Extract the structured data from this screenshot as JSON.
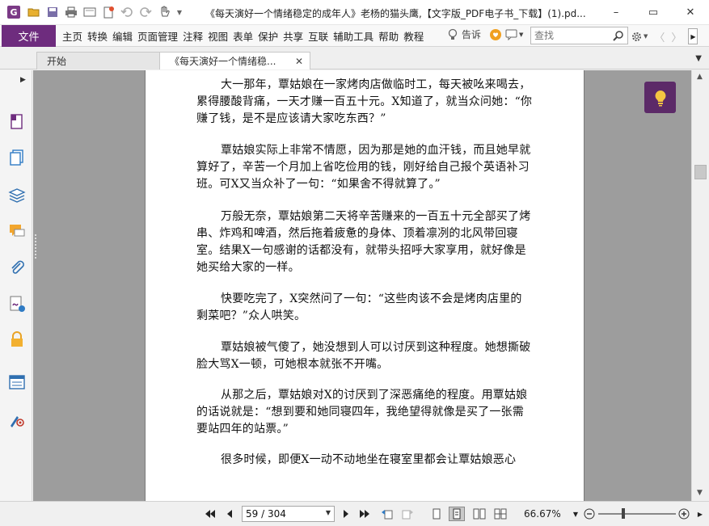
{
  "colors": {
    "brand": "#6e2c7e",
    "bulb_bg": "#5c2a68",
    "doc_background": "#9d9d9d"
  },
  "titlebar": {
    "app_icon": "G",
    "quick_access": [
      "app-logo-icon",
      "open-folder-icon",
      "save-icon",
      "print-icon",
      "screen-icon",
      "new-doc-icon",
      "undo-icon",
      "redo-icon",
      "hand-tool-icon",
      "customize-dropdown-icon"
    ],
    "title": "《每天演好一个情绪稳定的成年人》老杨的猫头鹰,【文字版_PDF电子书_下载】(1).pd...",
    "controls": {
      "min": "–",
      "max": "▭",
      "close": "✕"
    }
  },
  "menubar": {
    "file_label": "文件",
    "items": [
      "主页",
      "转换",
      "编辑",
      "页面管理",
      "注释",
      "视图",
      "表单",
      "保护",
      "共享",
      "互联",
      "辅助工具",
      "帮助",
      "教程"
    ],
    "tell_me": "告诉",
    "search_placeholder": "查找"
  },
  "tabs": {
    "items": [
      {
        "label": "开始",
        "active": false
      },
      {
        "label": "《每天演好一个情绪稳...",
        "active": true
      }
    ],
    "close_glyph": "✕"
  },
  "sidebar": {
    "icons": [
      "page-thumbnail-icon",
      "pages-icon",
      "layers-icon",
      "comments-icon",
      "attachments-icon",
      "signature-icon",
      "security-icon",
      "form-fields-icon",
      "certificate-icon"
    ]
  },
  "document": {
    "paragraphs": [
      "大一那年，覃姑娘在一家烤肉店做临时工，每天被吆来喝去，累得腰酸背痛，一天才赚一百五十元。X知道了，就当众问她：“你赚了钱，是不是应该请大家吃东西？”",
      "覃姑娘实际上非常不情愿，因为那是她的血汗钱，而且她早就算好了，辛苦一个月加上省吃俭用的钱，刚好给自己报个英语补习班。可X又当众补了一句：“如果舍不得就算了。”",
      "万般无奈，覃姑娘第二天将辛苦赚来的一百五十元全部买了烤串、炸鸡和啤酒，然后拖着疲惫的身体、顶着凛冽的北风带回寝室。结果X一句感谢的话都没有，就带头招呼大家享用，就好像是她买给大家的一样。",
      "快要吃完了，X突然问了一句：“这些肉该不会是烤肉店里的剩菜吧？”众人哄笑。",
      "覃姑娘被气傻了，她没想到人可以讨厌到这种程度。她想撕破脸大骂X一顿，可她根本就张不开嘴。",
      "从那之后，覃姑娘对X的讨厌到了深恶痛绝的程度。用覃姑娘的话说就是：“想到要和她同寝四年，我绝望得就像是买了一张需要站四年的站票。”",
      "很多时候，即便X一动不动地坐在寝室里都会让覃姑娘恶心"
    ]
  },
  "statusbar": {
    "page_value": "59 / 304",
    "zoom": "66.67%"
  }
}
